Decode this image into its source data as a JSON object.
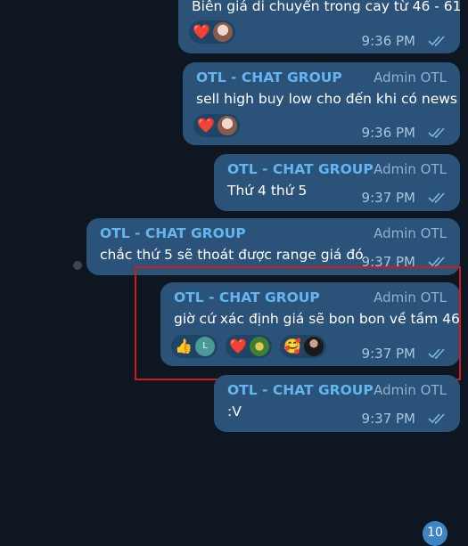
{
  "messages": [
    {
      "text": "Biên giá di chuyển trong cay từ 46 - 61",
      "time": "9:36 PM",
      "reactions": [
        {
          "type": "heart",
          "glyph": "❤️"
        }
      ]
    },
    {
      "sender": "OTL - CHAT GROUP",
      "role": "Admin OTL",
      "text": "sell high buy low cho đến khi có news",
      "time": "9:36 PM",
      "reactions": [
        {
          "type": "heart",
          "glyph": "❤️"
        }
      ]
    },
    {
      "sender": "OTL - CHAT GROUP",
      "role": "Admin OTL",
      "text": "Thứ 4 thứ 5",
      "time": "9:37 PM"
    },
    {
      "sender": "OTL - CHAT GROUP",
      "role": "Admin OTL",
      "text": "chắc thứ 5 sẽ thoát được range giá đó",
      "time": "9:37 PM"
    },
    {
      "sender": "OTL - CHAT GROUP",
      "role": "Admin OTL",
      "text": "giờ cứ xác định giá sẽ bon bon về tầm 46",
      "time": "9:37 PM",
      "reactions": [
        {
          "type": "thumbs-up",
          "glyph": "👍",
          "avatar_letter": "L"
        },
        {
          "type": "heart",
          "glyph": "❤️"
        },
        {
          "type": "smiling-face-hearts",
          "glyph": "🥰"
        }
      ]
    },
    {
      "sender": "OTL - CHAT GROUP",
      "role": "Admin OTL",
      "text": ":V",
      "time": "9:37 PM"
    }
  ],
  "unread_count": "10",
  "colors": {
    "background": "#0e1621",
    "bubble": "#2b5278",
    "sender": "#64b5ef",
    "highlight": "#d11b1b"
  }
}
